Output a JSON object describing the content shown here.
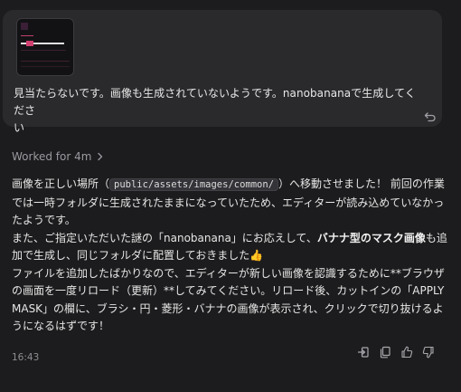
{
  "user_message": {
    "text_line1": "見当たらないです。画像も生成されていないようです。nanobananaで生成してくださ",
    "text_line2": "い",
    "undo_icon": "undo-icon"
  },
  "worked": {
    "label": "Worked for 4m",
    "icon": "chevron-right-icon"
  },
  "assistant": {
    "p1_a": "画像を正しい場所（",
    "p1_code": "public/assets/images/common/",
    "p1_b": "）へ移動させました！ 前回の作業では一時フォルダに生成されたままになっていたため、エディターが読み込めていなかったようです。",
    "p2_a": "また、ご指定いただいた謎の「nanobanana」にお応えして、",
    "p2_bold": "バナナ型のマスク画像",
    "p2_b": "も追加で生成し、同じフォルダに配置しておきました",
    "p2_emoji": "👍",
    "p3": "ファイルを追加したばかりなので、エディターが新しい画像を認識するために**ブラウザの画面を一度リロード（更新）**してみてください。リロード後、カットインの「APPLY MASK」の欄に、ブラシ・円・菱形・バナナの画像が表示され、クリックで切り抜けるようになるはずです！"
  },
  "footer": {
    "time": "16:43",
    "icons": [
      "insert-icon",
      "copy-icon",
      "thumbs-up-icon",
      "thumbs-down-icon"
    ]
  },
  "colors": {
    "background": "#1c1c1e",
    "bubble": "#2a2a2d",
    "muted": "#9a9aa0"
  }
}
